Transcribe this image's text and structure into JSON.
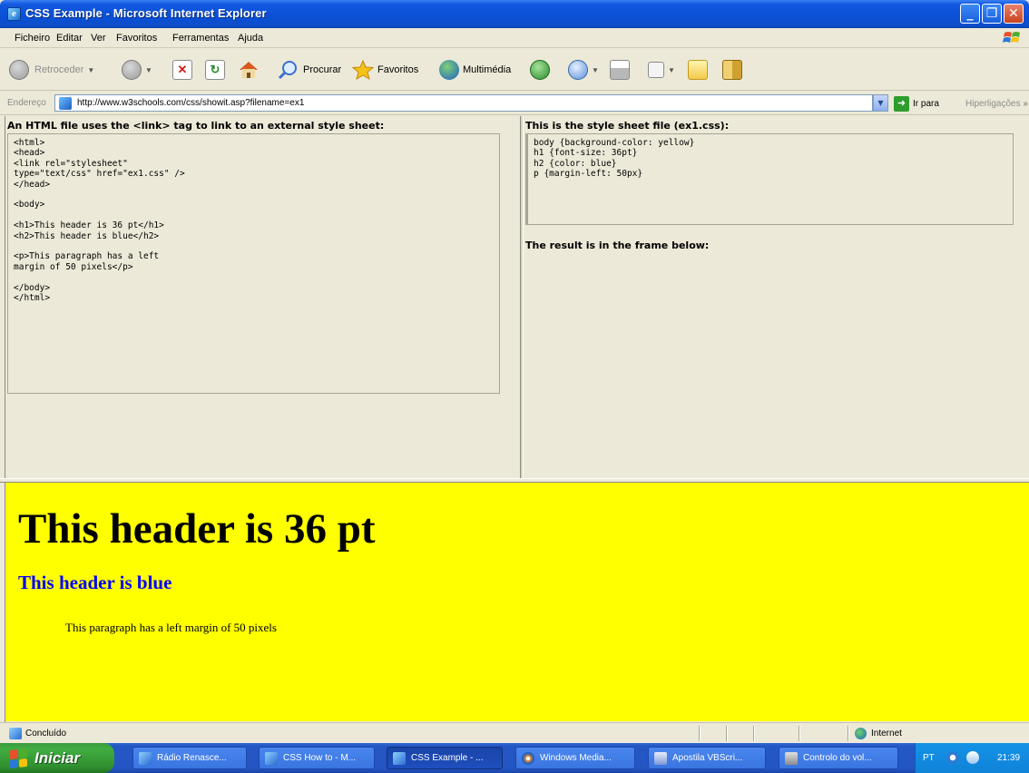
{
  "window": {
    "title": "CSS Example - Microsoft Internet Explorer",
    "minimize": "_",
    "maximize": "❐",
    "close": "✕"
  },
  "menu": [
    "Ficheiro",
    "Editar",
    "Ver",
    "Favoritos",
    "Ferramentas",
    "Ajuda"
  ],
  "toolbar": {
    "back_label": "Retroceder",
    "search_label": "Procurar",
    "favorites_label": "Favoritos",
    "media_label": "Multimédia"
  },
  "address": {
    "label": "Endereço",
    "url": "http://www.w3schools.com/css/showit.asp?filename=ex1",
    "go_label": "Ir para",
    "links_label": "Hiperligações",
    "links_chevron": "»"
  },
  "left_frame": {
    "heading": "An HTML file uses the <link> tag to link to an external style sheet:",
    "code": "<html>\n<head>\n<link rel=\"stylesheet\"\ntype=\"text/css\" href=\"ex1.css\" />\n</head>\n\n<body>\n\n<h1>This header is 36 pt</h1>\n<h2>This header is blue</h2>\n\n<p>This paragraph has a left\nmargin of 50 pixels</p>\n\n</body>\n</html>"
  },
  "right_frame": {
    "heading": "This is the style sheet file (ex1.css):",
    "code": "body {background-color: yellow}\nh1 {font-size: 36pt}\nh2 {color: blue}\np {margin-left: 50px}",
    "result_note": "The result is in the frame below:"
  },
  "result": {
    "h1": "This header is 36 pt",
    "h2": "This header is blue",
    "p": "This paragraph has a left margin of 50 pixels",
    "background": "#ffff00",
    "h2_color": "#0000ff"
  },
  "status": {
    "text": "Concluído",
    "zone": "Internet"
  },
  "taskbar": {
    "start_label": "Iniciar",
    "tasks": [
      {
        "label": "Rádio Renasce...",
        "active": false
      },
      {
        "label": "CSS How to - M...",
        "active": false
      },
      {
        "label": "CSS Example - ...",
        "active": true
      },
      {
        "label": "Windows Media...",
        "active": false
      },
      {
        "label": "Apostila VBScri...",
        "active": false
      },
      {
        "label": "Controlo do vol...",
        "active": false
      }
    ],
    "tray_lang": "PT",
    "clock": "21:39"
  },
  "colors": {
    "xp_blue": "#0a4fd5",
    "start_green": "#3c9a3c",
    "tray_blue": "#0f83d8"
  }
}
